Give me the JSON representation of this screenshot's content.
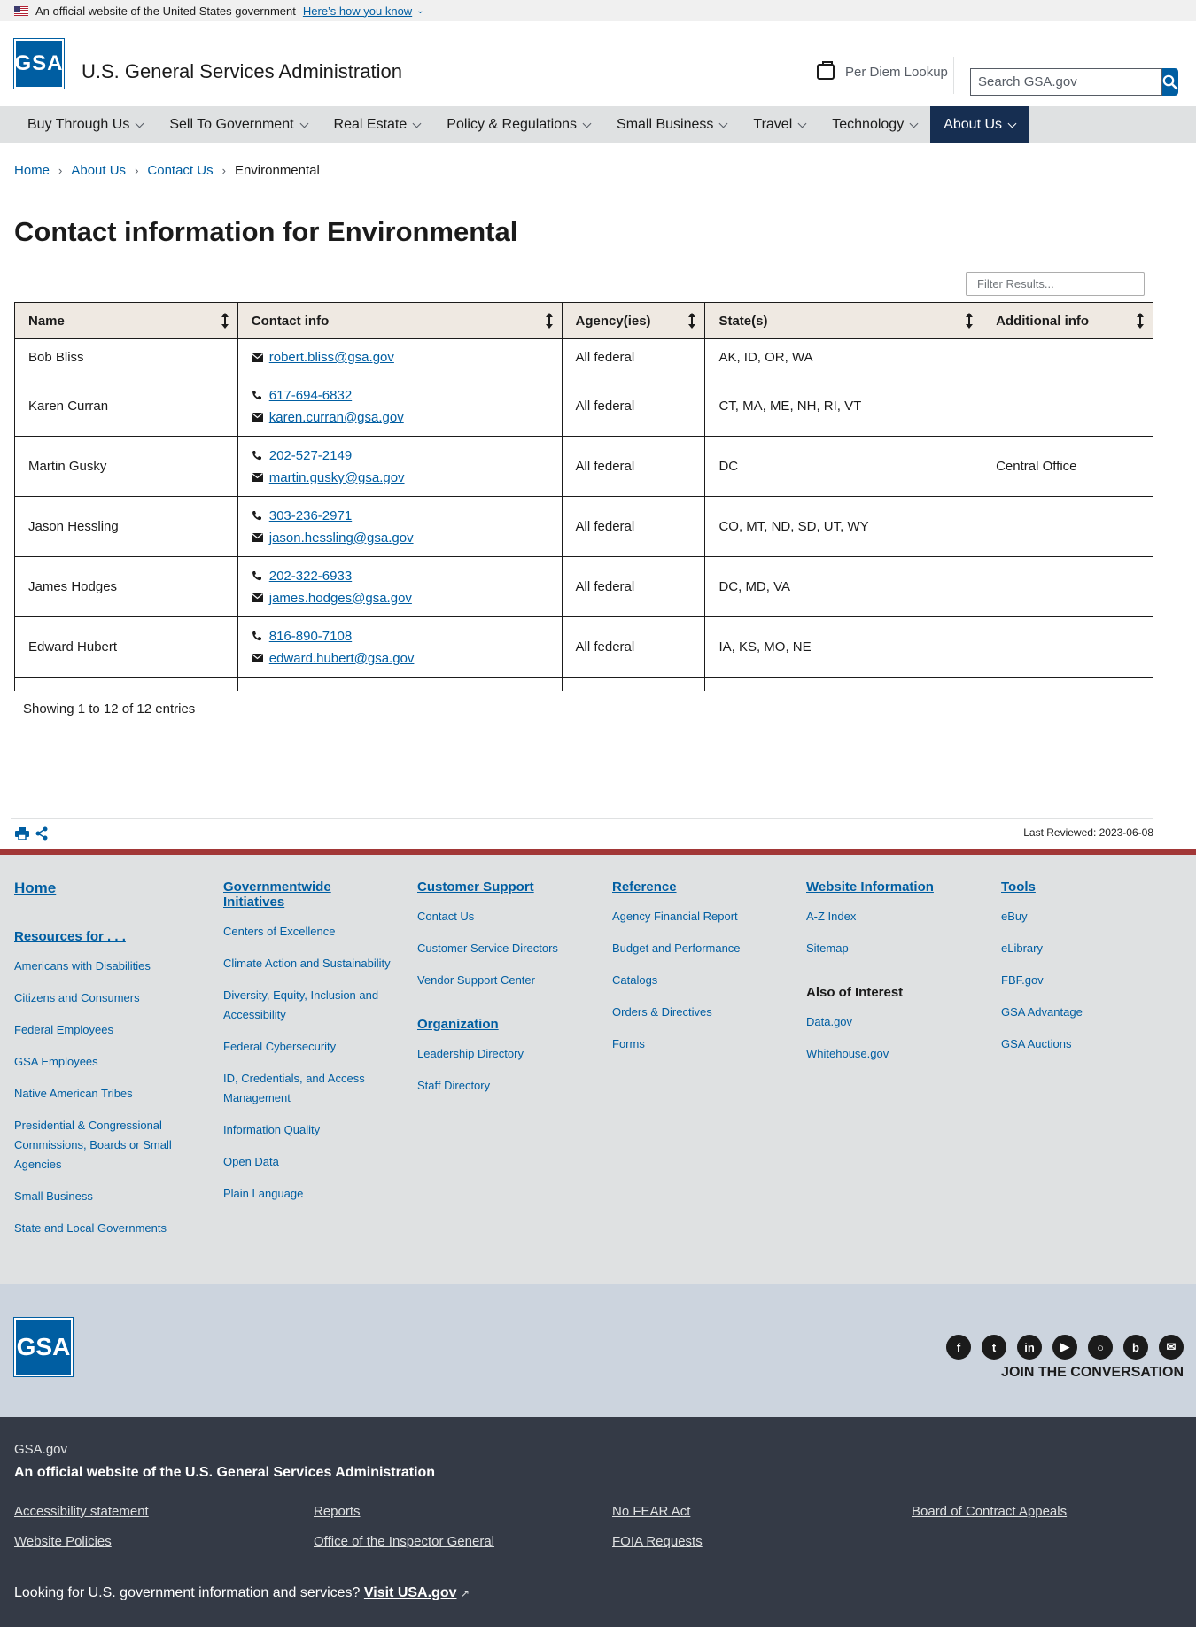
{
  "gov_banner": {
    "text": "An official website of the United States government",
    "link": "Here’s how you know"
  },
  "header": {
    "logo": "GSA",
    "site_title": "U.S. General Services Administration",
    "per_diem": "Per Diem Lookup",
    "search_placeholder": "Search GSA.gov"
  },
  "nav": [
    "Buy Through Us",
    "Sell To Government",
    "Real Estate",
    "Policy & Regulations",
    "Small Business",
    "Travel",
    "Technology",
    "About Us"
  ],
  "breadcrumb": [
    "Home",
    "About Us",
    "Contact Us",
    "Environmental"
  ],
  "page_title": "Contact information for Environmental",
  "filter_placeholder": "Filter Results...",
  "table": {
    "headers": [
      "Name",
      "Contact info",
      "Agency(ies)",
      "State(s)",
      "Additional info"
    ],
    "rows": [
      {
        "name": "Bob Bliss",
        "phone": "",
        "email": "robert.bliss@gsa.gov",
        "agency": "All federal",
        "states": "AK, ID, OR, WA",
        "info": ""
      },
      {
        "name": "Karen Curran",
        "phone": "617-694-6832",
        "email": "karen.curran@gsa.gov",
        "agency": "All federal",
        "states": "CT, MA, ME, NH, RI, VT",
        "info": ""
      },
      {
        "name": "Martin Gusky",
        "phone": "202-527-2149",
        "email": "martin.gusky@gsa.gov",
        "agency": "All federal",
        "states": "DC",
        "info": "Central Office"
      },
      {
        "name": "Jason Hessling",
        "phone": "303-236-2971",
        "email": "jason.hessling@gsa.gov",
        "agency": "All federal",
        "states": "CO, MT, ND, SD, UT, WY",
        "info": ""
      },
      {
        "name": "James Hodges",
        "phone": "202-322-6933",
        "email": "james.hodges@gsa.gov",
        "agency": "All federal",
        "states": "DC, MD, VA",
        "info": ""
      },
      {
        "name": "Edward Hubert",
        "phone": "816-890-7108",
        "email": "edward.hubert@gsa.gov",
        "agency": "All federal",
        "states": "IA, KS, MO, NE",
        "info": ""
      }
    ]
  },
  "showing": "Showing 1 to 12 of 12 entries",
  "last_reviewed": "Last Reviewed: 2023-06-08",
  "footer": {
    "home": "Home",
    "resources_head": "Resources for . . .",
    "resources": [
      "Americans with Disabilities",
      "Citizens and Consumers",
      "Federal Employees",
      "GSA Employees",
      "Native American Tribes",
      "Presidential & Congressional Commissions, Boards or Small Agencies",
      "Small Business",
      "State and Local Governments"
    ],
    "initiatives_head": "Governmentwide Initiatives",
    "initiatives": [
      "Centers of Excellence",
      "Climate Action and Sustainability",
      "Diversity, Equity, Inclusion and Accessibility",
      "Federal Cybersecurity",
      "ID, Credentials, and Access Management",
      "Information Quality",
      "Open Data",
      "Plain Language"
    ],
    "support_head": "Customer Support",
    "support": [
      "Contact Us",
      "Customer Service Directors",
      "Vendor Support Center"
    ],
    "org_head": "Organization",
    "org": [
      "Leadership Directory",
      "Staff Directory"
    ],
    "reference_head": "Reference",
    "reference": [
      "Agency Financial Report",
      "Budget and Performance",
      "Catalogs",
      "Orders & Directives",
      "Forms"
    ],
    "webinfo_head": "Website Information",
    "webinfo": [
      "A-Z Index",
      "Sitemap"
    ],
    "interest_head": "Also of Interest",
    "interest": [
      "Data.gov",
      "Whitehouse.gov"
    ],
    "tools_head": "Tools",
    "tools": [
      "eBuy",
      "eLibrary",
      "FBF.gov",
      "GSA Advantage",
      "GSA Auctions"
    ],
    "logo": "GSA",
    "join": "JOIN THE CONVERSATION",
    "org_name": "GSA.gov",
    "official": "An official website of the U.S. General Services Administration",
    "bottom_links": [
      "Accessibility statement",
      "Reports",
      "No FEAR Act",
      "Board of Contract Appeals",
      "Website Policies",
      "Office of the Inspector General",
      "FOIA Requests"
    ],
    "usa_text": "Looking for U.S. government information and services?",
    "usa_link": "Visit USA.gov"
  }
}
